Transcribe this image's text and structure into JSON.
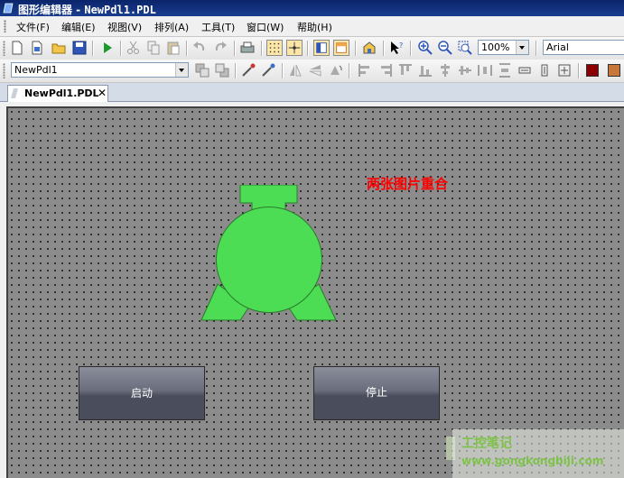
{
  "window": {
    "title": "图形编辑器 - ",
    "file": "NewPdl1.PDL"
  },
  "menu": [
    "文件(F)",
    "编辑(E)",
    "视图(V)",
    "排列(A)",
    "工具(T)",
    "窗口(W)",
    "帮助(H)"
  ],
  "toolbar": {
    "zoom": "100%",
    "font": "Arial"
  },
  "object_select": {
    "value": "NewPdl1"
  },
  "tab": {
    "label": "NewPdl1.PDL",
    "close": "✕"
  },
  "canvas": {
    "note": "两张图片重合",
    "start_label": "启动",
    "stop_label": "停止",
    "colors": {
      "motor": "#4cdd55",
      "note": "#ff0000"
    }
  },
  "watermark": {
    "line1": "工控笔记",
    "line2": "www.gongkongbiji.com"
  }
}
